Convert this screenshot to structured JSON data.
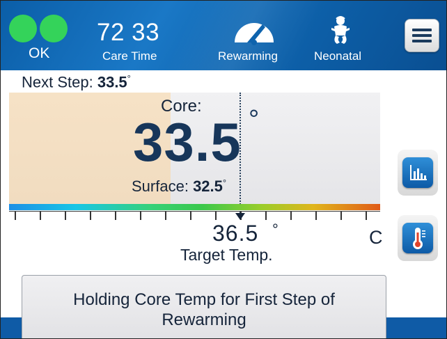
{
  "header": {
    "status": {
      "label": "OK",
      "indicator_color": "#34d35a"
    },
    "care_time": {
      "value": "72 33",
      "label": "Care Time"
    },
    "mode": {
      "label": "Rewarming",
      "icon": "gauge-icon"
    },
    "patient": {
      "label": "Neonatal",
      "icon": "baby-icon"
    },
    "menu": {
      "icon": "hamburger-menu-icon"
    }
  },
  "next_step": {
    "label": "Next Step:",
    "value": "33.5",
    "degree": "°"
  },
  "core": {
    "label": "Core:",
    "value": "33.5",
    "degree": "°"
  },
  "surface": {
    "label": "Surface:",
    "value": "32.5",
    "degree": "°"
  },
  "target": {
    "value": "36.5",
    "degree": "°",
    "label": "Target Temp.",
    "unit": "C"
  },
  "side_buttons": [
    {
      "icon": "bar-chart-icon"
    },
    {
      "icon": "thermometer-icon"
    }
  ],
  "message": {
    "line1": "Holding Core Temp for First Step of",
    "line2": "Rewarming"
  },
  "colors": {
    "header_blue": "#0e63ad",
    "accent_blue": "#1a78c6",
    "status_green": "#34d35a",
    "text_dark": "#15243a"
  }
}
